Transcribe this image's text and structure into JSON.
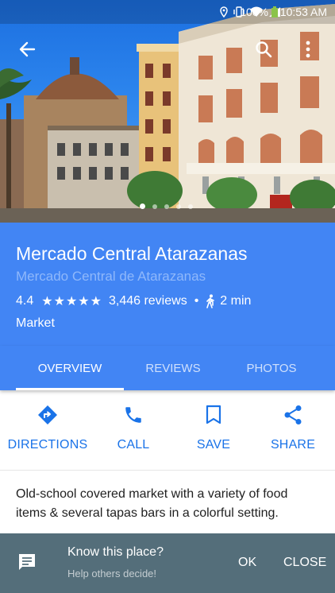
{
  "status_bar": {
    "battery_percent": "100%",
    "time": "10:53 AM"
  },
  "hero": {
    "photo_dots": 5,
    "active_dot": 0
  },
  "place": {
    "name": "Mercado Central Atarazanas",
    "local_name": "Mercado Central de Atarazanas",
    "rating": "4.4",
    "stars": "★★★★★",
    "reviews": "3,446 reviews",
    "separator": "•",
    "walk_time": "2 min",
    "category": "Market"
  },
  "tabs": [
    {
      "label": "OVERVIEW"
    },
    {
      "label": "REVIEWS"
    },
    {
      "label": "PHOTOS"
    }
  ],
  "actions": [
    {
      "label": "DIRECTIONS",
      "icon": "directions-icon"
    },
    {
      "label": "CALL",
      "icon": "phone-icon"
    },
    {
      "label": "SAVE",
      "icon": "bookmark-icon"
    },
    {
      "label": "SHARE",
      "icon": "share-icon"
    }
  ],
  "description": "Old-school covered market with a variety of food items & several tapas bars in a colorful setting.",
  "snackbar": {
    "title": "Know this place?",
    "subtitle": "Help others decide!",
    "ok": "OK",
    "close": "CLOSE"
  },
  "colors": {
    "primary": "#4285f4",
    "action_blue": "#1a73e8",
    "snackbar": "#546e7a"
  }
}
